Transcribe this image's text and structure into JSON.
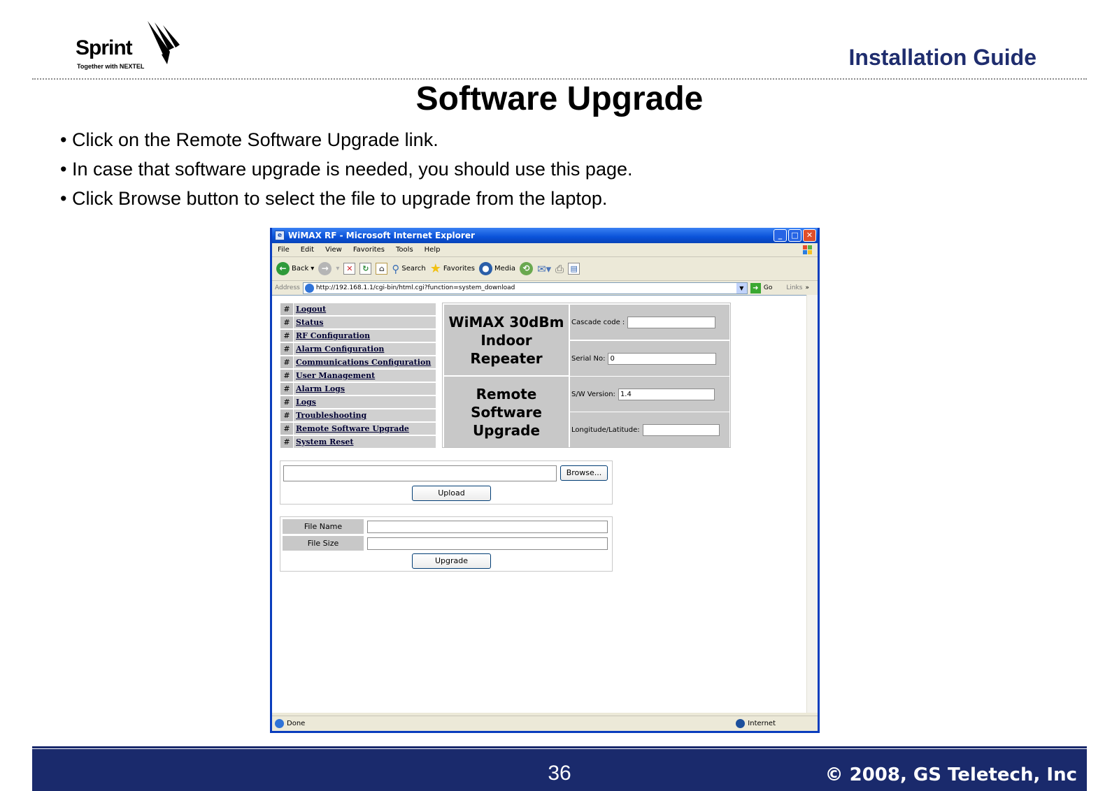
{
  "slide": {
    "logo_word": "Sprint",
    "logo_tagline": "Together with NEXTEL",
    "guide_label": "Installation Guide",
    "title": "Software Upgrade",
    "bullets": [
      "• Click on the Remote Software Upgrade link.",
      "• In case that software upgrade is needed, you should use this page.",
      "• Click Browse button to select the file to upgrade from the laptop."
    ],
    "page_number": "36",
    "copyright": "© 2008, GS Teletech, Inc"
  },
  "browser": {
    "window_title": "WiMAX RF - Microsoft Internet Explorer",
    "menu": [
      "File",
      "Edit",
      "View",
      "Favorites",
      "Tools",
      "Help"
    ],
    "toolbar": {
      "back": "Back",
      "search": "Search",
      "favorites": "Favorites",
      "media": "Media"
    },
    "address_label": "Address",
    "address_url": "http://192.168.1.1/cgi-bin/html.cgi?function=system_download",
    "go_label": "Go",
    "links_label": "Links",
    "status_text": "Done",
    "zone_text": "Internet"
  },
  "page": {
    "nav_marker": "#",
    "nav_items": [
      "Logout",
      "Status",
      "RF Configuration",
      "Alarm Configuration",
      "Communications Configuration",
      "User Management",
      "Alarm Logs",
      "Logs",
      "Troubleshooting",
      "Remote Software Upgrade",
      "System Reset"
    ],
    "device_title_line1": "WiMAX 30dBm",
    "device_title_line2": "Indoor Repeater",
    "section_title_line1": "Remote Software",
    "section_title_line2": "Upgrade",
    "cascade_label": "Cascade code :",
    "cascade_value": "",
    "serial_label": "Serial No:",
    "serial_value": "0",
    "sw_label": "S/W Version:",
    "sw_value": "1.4",
    "lonlat_label": "Longitude/Latitude:",
    "lonlat_value": "",
    "browse_label": "Browse...",
    "upload_label": "Upload",
    "file_name_label": "File Name",
    "file_size_label": "File Size",
    "upgrade_label": "Upgrade"
  },
  "colors": {
    "brand_navy": "#1a2a6c",
    "guide_text": "#1f2d6e",
    "xp_title_blue": "#0a52d9"
  }
}
